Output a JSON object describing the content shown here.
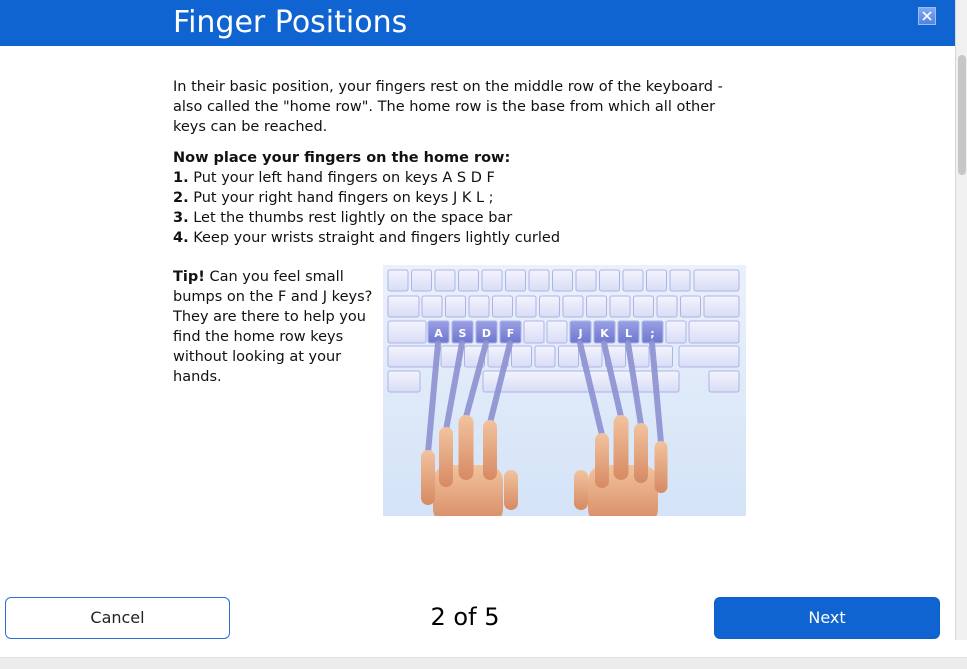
{
  "window": {
    "title": "Finger Positions",
    "close_icon": "close-icon",
    "accent": "#0f64d2"
  },
  "content": {
    "intro": "In their basic position, your fingers rest on the middle row of the keyboard - also called the \"home row\". The home row is the base from which all other keys can be reached.",
    "steps_heading": "Now place your fingers on the home row:",
    "steps": [
      {
        "num": "1.",
        "text": "Put your left hand fingers on keys A S D F"
      },
      {
        "num": "2.",
        "text": "Put your right hand fingers on keys J K L ;"
      },
      {
        "num": "3.",
        "text": "Let the thumbs rest lightly on the space bar"
      },
      {
        "num": "4.",
        "text": "Keep your wrists straight and fingers lightly curled"
      }
    ],
    "tip_label": "Tip!",
    "tip_text": "Can you feel small bumps on the F and J keys? They are there to help you find the home row keys without looking at your hands."
  },
  "illustration": {
    "home_keys": [
      "A",
      "S",
      "D",
      "F",
      "J",
      "K",
      "L",
      ";"
    ],
    "key_color": "#e6e9fb",
    "home_key_color": "#7b83d6"
  },
  "footer": {
    "cancel_label": "Cancel",
    "page_indicator": "2 of 5",
    "next_label": "Next"
  }
}
